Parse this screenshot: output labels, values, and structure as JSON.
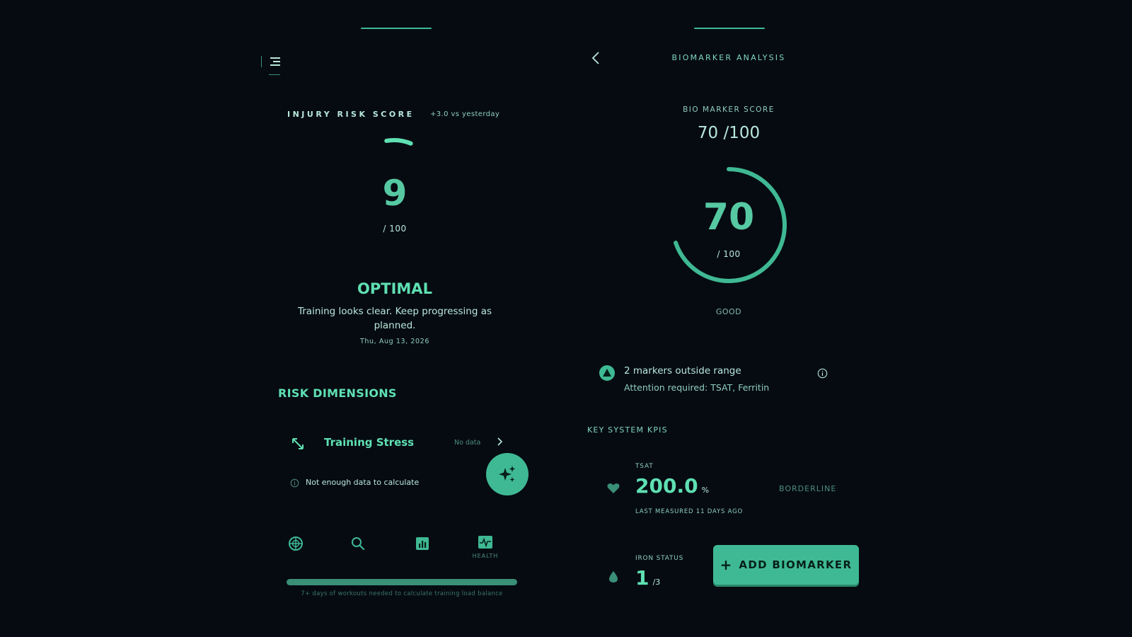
{
  "injury_screen": {
    "title": "INJURY RISK SCORE",
    "delta": "+3.0 vs yesterday",
    "score": "9",
    "score_fraction": 0.09,
    "out_of": "/ 100",
    "status": "OPTIMAL",
    "status_description": "Training looks clear. Keep progressing as planned.",
    "date": "Thu, Aug 13, 2026",
    "risk_dimensions_title": "RISK DIMENSIONS",
    "dimension": {
      "label": "Training Stress",
      "value": "No data",
      "hint": "Not enough data to calculate"
    },
    "nav": {
      "health_label": "HEALTH"
    },
    "training_balance": {
      "progress": 1.0,
      "note": "7+ days of workouts needed to calculate training load balance"
    }
  },
  "biomarker_screen": {
    "header_title": "BIOMARKER ANALYSIS",
    "score_label": "BIO MARKER SCORE",
    "score_text": "70 /100",
    "ring_value": "70",
    "ring_fraction": 0.7,
    "ring_out_of": "/ 100",
    "rating": "GOOD",
    "alert": {
      "title": "2 markers outside range",
      "subtitle": "Attention required: TSAT, Ferritin"
    },
    "kpis_title": "KEY SYSTEM KPIS",
    "kpis": [
      {
        "name": "TSAT",
        "value": "200.0",
        "unit": "%",
        "status": "BORDERLINE",
        "last_measured": "LAST MEASURED 11 DAYS AGO"
      },
      {
        "name": "IRON STATUS",
        "value": "1",
        "unit": "/3"
      }
    ],
    "add_button_label": "ADD BIOMARKER",
    "add_button_icon": "+"
  },
  "colors": {
    "background": "#060b12",
    "accent": "#3fb993",
    "accent_light": "#5fe0b2",
    "text_light": "#b8e8da"
  }
}
